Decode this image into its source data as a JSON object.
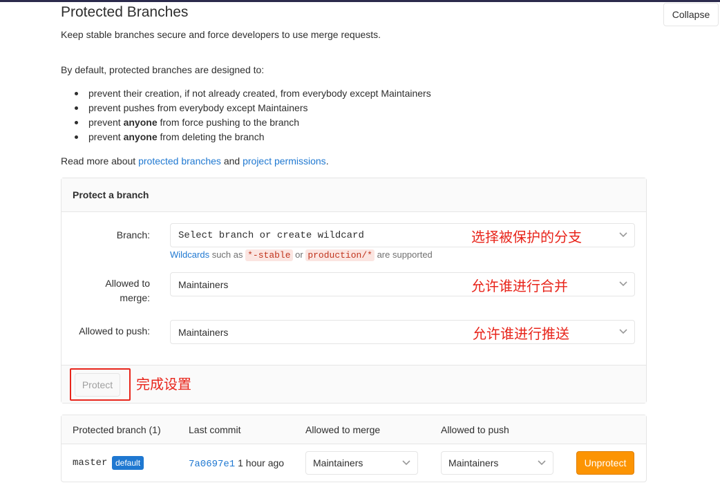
{
  "header": {
    "title": "Protected Branches",
    "collapse_label": "Collapse",
    "subtitle": "Keep stable branches secure and force developers to use merge requests."
  },
  "intro": {
    "lead": "By default, protected branches are designed to:",
    "rules": [
      {
        "pre": "prevent their creation, if not already created, from everybody except Maintainers",
        "bold": "",
        "post": ""
      },
      {
        "pre": "prevent pushes from everybody except Maintainers",
        "bold": "",
        "post": ""
      },
      {
        "pre": "prevent ",
        "bold": "anyone",
        "post": " from force pushing to the branch"
      },
      {
        "pre": "prevent ",
        "bold": "anyone",
        "post": " from deleting the branch"
      }
    ],
    "read_more_prefix": "Read more about ",
    "link_protected_branches": "protected branches",
    "read_more_and": " and ",
    "link_project_permissions": "project permissions",
    "read_more_suffix": "."
  },
  "protect_form": {
    "header": "Protect a branch",
    "branch_label": "Branch:",
    "branch_placeholder": "Select branch or create wildcard",
    "branch_annotation": "选择被保护的分支",
    "help_link": "Wildcards",
    "help_such_as": " such as ",
    "help_code1": "*-stable",
    "help_or": " or ",
    "help_code2": "production/*",
    "help_supported": " are supported",
    "merge_label_line1": "Allowed to",
    "merge_label_line2": "merge:",
    "merge_value": "Maintainers",
    "merge_annotation": "允许谁进行合并",
    "push_label": "Allowed to push:",
    "push_value": "Maintainers",
    "push_annotation": "允许谁进行推送",
    "protect_button": "Protect",
    "protect_annotation": "完成设置"
  },
  "table": {
    "headers": {
      "branch": "Protected branch (1)",
      "commit": "Last commit",
      "merge": "Allowed to merge",
      "push": "Allowed to push"
    },
    "rows": [
      {
        "branch": "master",
        "badge": "default",
        "commit_sha": "7a0697e1",
        "commit_time": "1 hour ago",
        "merge": "Maintainers",
        "push": "Maintainers",
        "action": "Unprotect"
      }
    ]
  },
  "colors": {
    "link": "#1f78d1",
    "annotation": "#e8251b",
    "unprotect": "#fc9403"
  }
}
